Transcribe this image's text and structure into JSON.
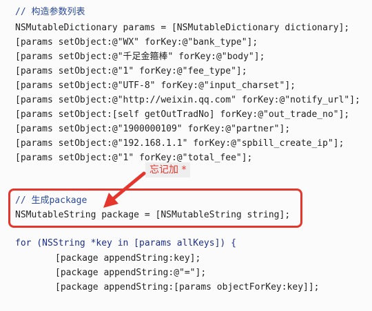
{
  "code": {
    "lines_top": [
      "// 构造参数列表",
      "NSMutableDictionary params = [NSMutableDictionary dictionary];",
      "[params setObject:@\"WX\" forKey:@\"bank_type\"];",
      "[params setObject:@\"千足金箍棒\" forKey:@\"body\"];",
      "[params setObject:@\"1\" forKey:@\"fee_type\"];",
      "[params setObject:@\"UTF-8\" forKey:@\"input_charset\"];",
      "[params setObject:@\"http://weixin.qq.com\" forKey:@\"notify_url\"];",
      "[params setObject:[self getOutTradNo] forKey:@\"out_trade_no\"];",
      "[params setObject:@\"1900000109\" forKey:@\"partner\"];",
      "[params setObject:@\"192.168.1.1\" forKey:@\"spbill_create_ip\"];",
      "[params setObject:@\"1\" forKey:@\"total_fee\"];"
    ],
    "highlighted": [
      "// 生成package",
      "NSMutableString package = [NSMutableString string];"
    ],
    "loop_header": "for (NSString *key in [params allKeys]) {",
    "loop_body": [
      "[package appendString:key];",
      "[package appendString:@\"=\"];",
      "[package appendString:[params objectForKey:key]];"
    ]
  },
  "annotation": {
    "text": "忘记加 *"
  },
  "colors": {
    "highlight": "#e4362d",
    "comment": "#2a4a9a"
  }
}
